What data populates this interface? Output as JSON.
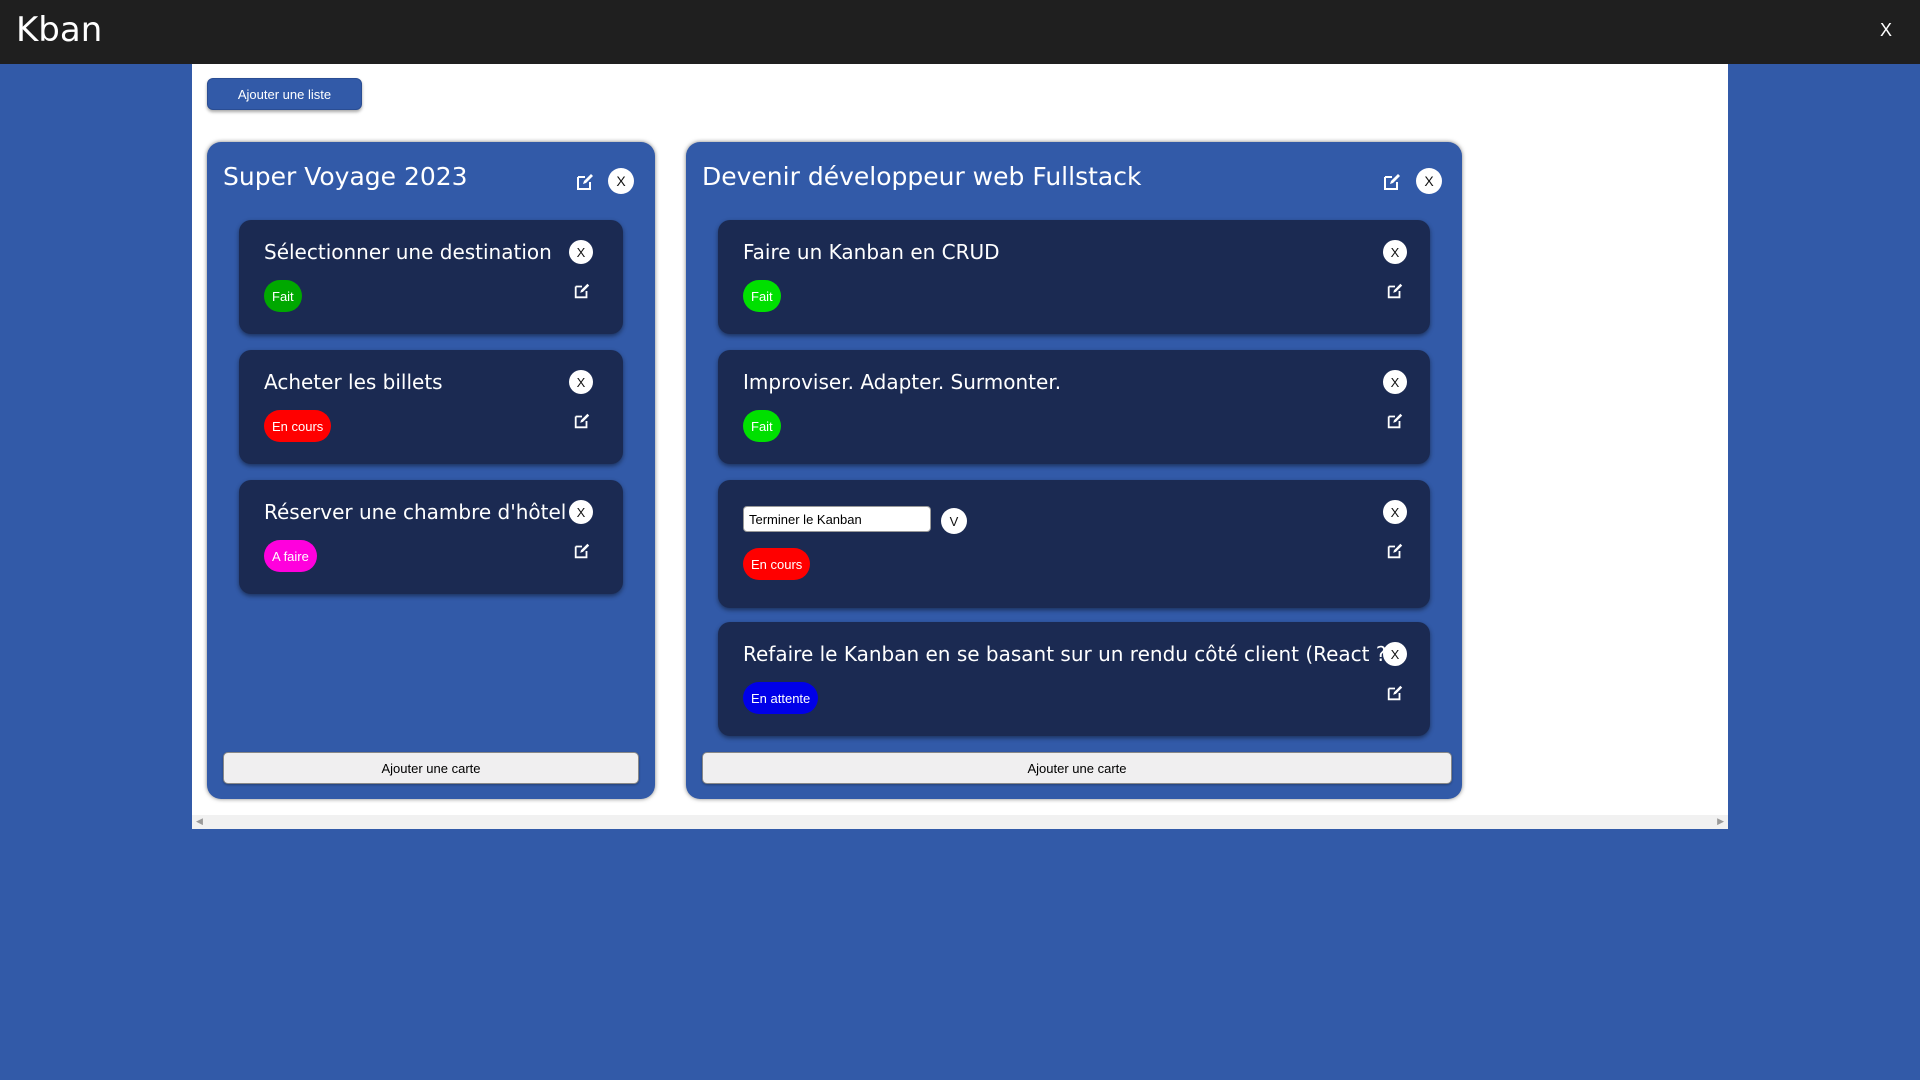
{
  "app": {
    "title": "Kban",
    "close_label": "X"
  },
  "board": {
    "add_list_label": "Ajouter une liste"
  },
  "lists": [
    {
      "title": "Super Voyage 2023",
      "close_label": "X",
      "add_card_label": "Ajouter une carte",
      "cards": [
        {
          "title": "Sélectionner une destination",
          "status": "Fait",
          "status_color": "#00A800",
          "close_label": "X"
        },
        {
          "title": "Acheter les billets",
          "status": "En cours",
          "status_color": "#FF0000",
          "close_label": "X"
        },
        {
          "title": "Réserver une chambre d'hôtel",
          "status": "A faire",
          "status_color": "#FF00DD",
          "close_label": "X"
        }
      ]
    },
    {
      "title": "Devenir développeur web Fullstack",
      "close_label": "X",
      "add_card_label": "Ajouter une carte",
      "cards": [
        {
          "title": "Faire un Kanban en CRUD",
          "status": "Fait",
          "status_color": "#00E000",
          "close_label": "X"
        },
        {
          "title": "Improviser. Adapter. Surmonter.",
          "status": "Fait",
          "status_color": "#00E000",
          "close_label": "X"
        },
        {
          "title_input_value": "Terminer le Kanban",
          "confirm_label": "V",
          "status": "En cours",
          "status_color": "#FF0000",
          "close_label": "X"
        },
        {
          "title": "Refaire le Kanban en se basant sur un rendu côté client (React ?)",
          "status": "En attente",
          "status_color": "#0000E8",
          "close_label": "X"
        }
      ]
    }
  ]
}
